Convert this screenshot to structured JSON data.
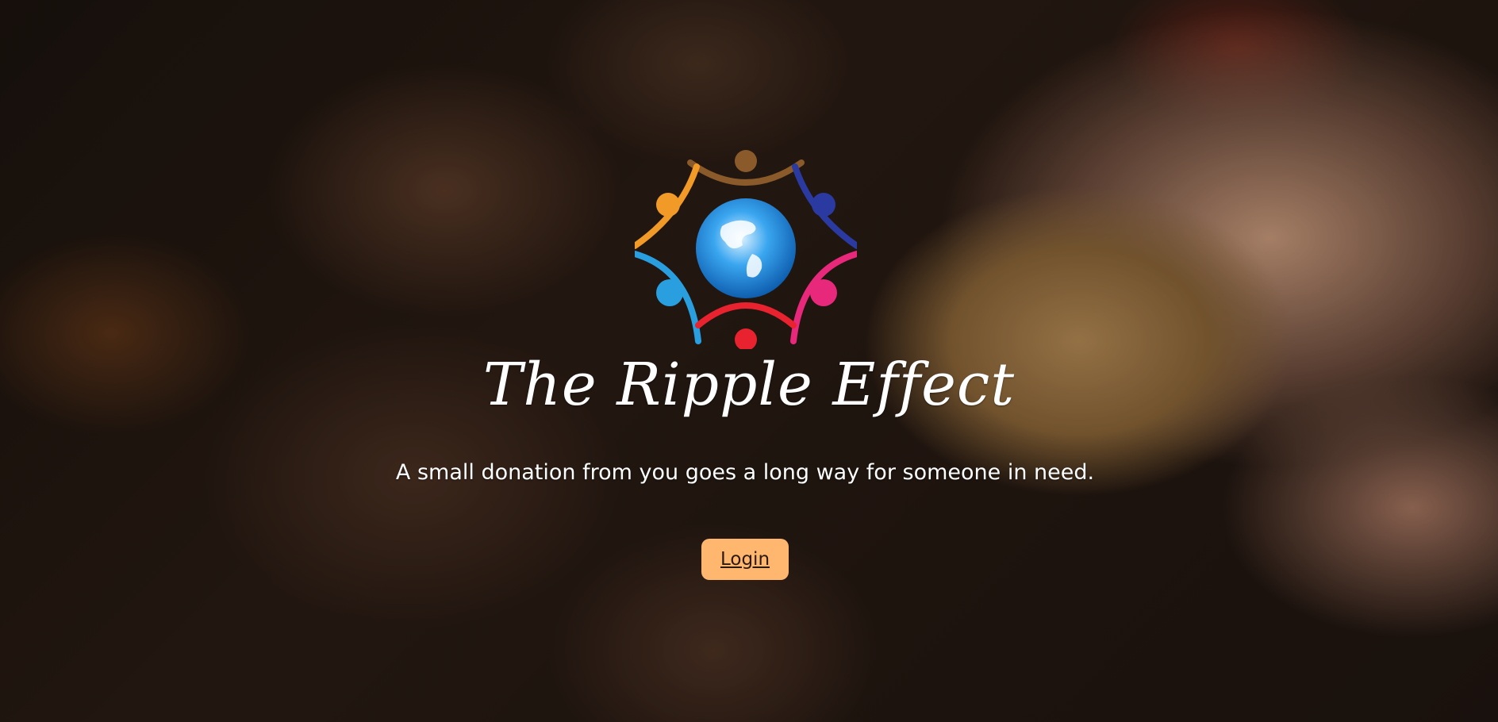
{
  "brand": {
    "title": "The Ripple Effect",
    "tagline": "A small donation from you goes a long way for someone in need."
  },
  "actions": {
    "login_label": "Login"
  },
  "colors": {
    "login_button": "#ffb66e",
    "logo_orange": "#f29a27",
    "logo_brown": "#8a5a2b",
    "logo_navy": "#2a3aa0",
    "logo_pink": "#e8287a",
    "logo_red": "#e8222e",
    "logo_blue": "#2a9fe0",
    "globe_blue": "#3aa6f0"
  },
  "icons": {
    "logo": "people-around-globe-icon"
  }
}
